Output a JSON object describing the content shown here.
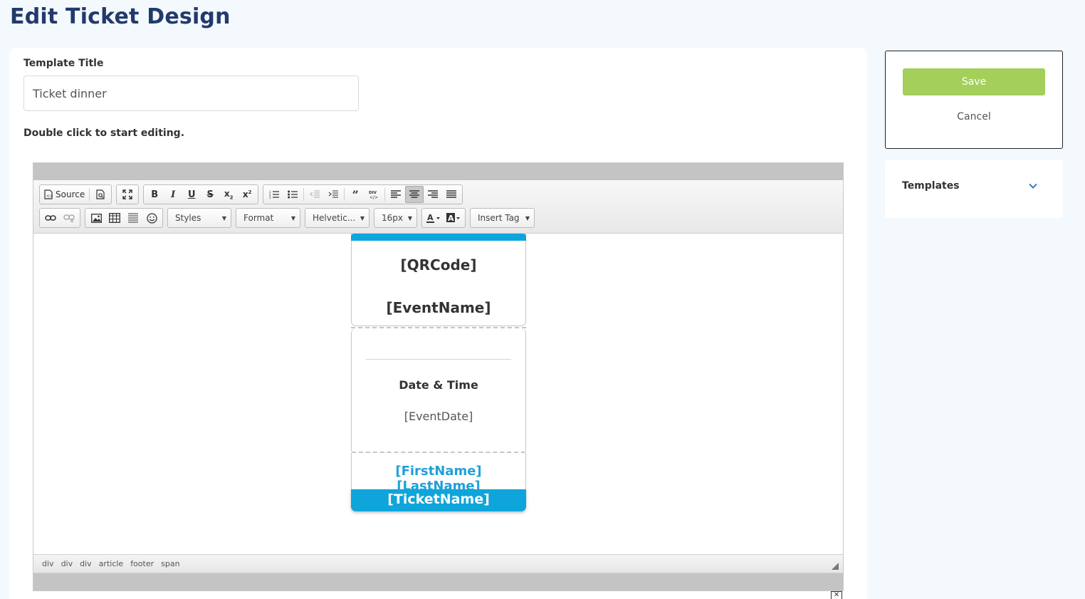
{
  "page": {
    "title": "Edit Ticket Design"
  },
  "form": {
    "template_title_label": "Template Title",
    "template_title_value": "Ticket dinner",
    "hint": "Double click to start editing."
  },
  "toolbar": {
    "source_label": "Source",
    "styles_label": "Styles",
    "format_label": "Format",
    "font_label": "Helvetic...",
    "size_label": "16px",
    "insert_tag_label": "Insert Tag"
  },
  "ticket": {
    "qr": "[QRCode]",
    "event_name": "[EventName]",
    "date_time_label": "Date & Time",
    "event_date": "[EventDate]",
    "attendee_name": "[FirstName] [LastName]",
    "ticket_name": "[TicketName]"
  },
  "statusbar": {
    "path": [
      "div",
      "div",
      "div",
      "article",
      "footer",
      "span"
    ]
  },
  "actions": {
    "save_label": "Save",
    "cancel_label": "Cancel"
  },
  "templates": {
    "title": "Templates"
  },
  "colors": {
    "accent_blue": "#0ea5db",
    "save_green": "#a3cf5a",
    "title_navy": "#223a6b"
  }
}
